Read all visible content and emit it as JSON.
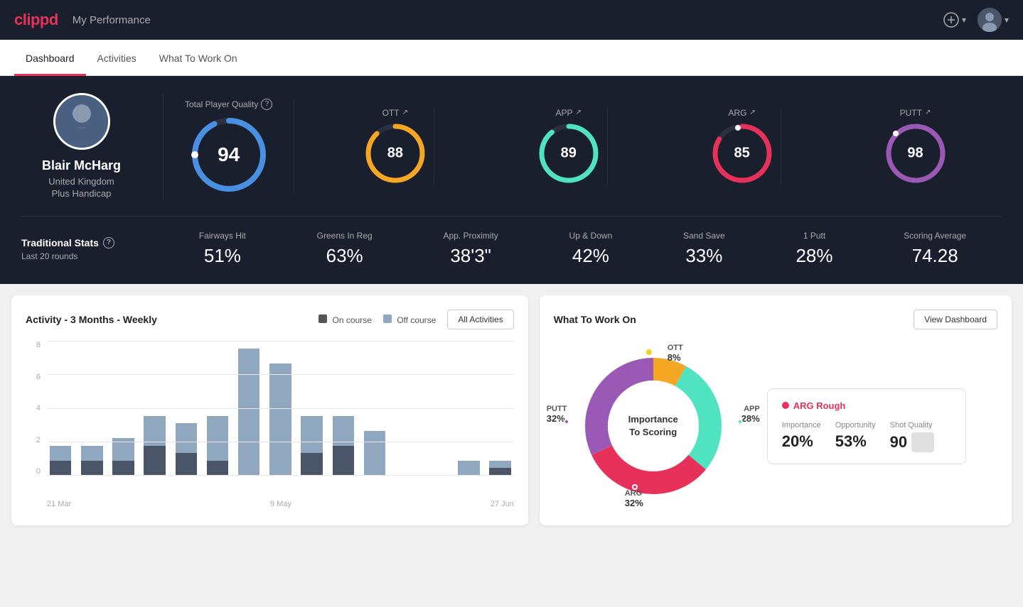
{
  "app": {
    "logo": "clippd",
    "header_title": "My Performance"
  },
  "nav": {
    "tabs": [
      {
        "id": "dashboard",
        "label": "Dashboard",
        "active": true
      },
      {
        "id": "activities",
        "label": "Activities",
        "active": false
      },
      {
        "id": "what-to-work-on",
        "label": "What To Work On",
        "active": false
      }
    ]
  },
  "player": {
    "name": "Blair McHarg",
    "country": "United Kingdom",
    "handicap": "Plus Handicap",
    "avatar_text": "👤"
  },
  "scores": {
    "total_quality_label": "Total Player Quality",
    "total_value": "94",
    "total_color": "#4a90e2",
    "categories": [
      {
        "label": "OTT",
        "value": "88",
        "color": "#f5a623"
      },
      {
        "label": "APP",
        "value": "89",
        "color": "#50e3c2"
      },
      {
        "label": "ARG",
        "value": "85",
        "color": "#e8315a"
      },
      {
        "label": "PUTT",
        "value": "98",
        "color": "#9b59b6"
      }
    ]
  },
  "trad_stats": {
    "title": "Traditional Stats",
    "subtitle": "Last 20 rounds",
    "items": [
      {
        "label": "Fairways Hit",
        "value": "51%"
      },
      {
        "label": "Greens In Reg",
        "value": "63%"
      },
      {
        "label": "App. Proximity",
        "value": "38'3\""
      },
      {
        "label": "Up & Down",
        "value": "42%"
      },
      {
        "label": "Sand Save",
        "value": "33%"
      },
      {
        "label": "1 Putt",
        "value": "28%"
      },
      {
        "label": "Scoring Average",
        "value": "74.28"
      }
    ]
  },
  "activity_chart": {
    "title": "Activity - 3 Months - Weekly",
    "legend": {
      "on_course": "On course",
      "off_course": "Off course"
    },
    "button_label": "All Activities",
    "y_labels": [
      "0",
      "2",
      "4",
      "6",
      "8"
    ],
    "x_labels": [
      "21 Mar",
      "9 May",
      "27 Jun"
    ],
    "bars": [
      {
        "on": 1,
        "off": 1
      },
      {
        "on": 1,
        "off": 1
      },
      {
        "on": 1,
        "off": 1.5
      },
      {
        "on": 2,
        "off": 2
      },
      {
        "on": 1.5,
        "off": 2
      },
      {
        "on": 1,
        "off": 3
      },
      {
        "on": 0,
        "off": 8.5
      },
      {
        "on": 0,
        "off": 7.5
      },
      {
        "on": 1.5,
        "off": 2.5
      },
      {
        "on": 2,
        "off": 2
      },
      {
        "on": 0,
        "off": 3
      },
      {
        "on": 0,
        "off": 0
      },
      {
        "on": 0,
        "off": 0
      },
      {
        "on": 0,
        "off": 1
      },
      {
        "on": 0.5,
        "off": 0.5
      }
    ]
  },
  "what_to_work_on": {
    "title": "What To Work On",
    "button_label": "View Dashboard",
    "donut_label": "Importance\nTo Scoring",
    "segments": [
      {
        "label": "OTT",
        "pct": 8,
        "color": "#f5a623",
        "pos": "top"
      },
      {
        "label": "APP",
        "pct": 28,
        "color": "#50e3c2",
        "pos": "right"
      },
      {
        "label": "ARG",
        "pct": 32,
        "color": "#e8315a",
        "pos": "bottom"
      },
      {
        "label": "PUTT",
        "pct": 32,
        "color": "#9b59b6",
        "pos": "left"
      }
    ],
    "info_card": {
      "title": "ARG Rough",
      "metrics": [
        {
          "label": "Importance",
          "value": "20%"
        },
        {
          "label": "Opportunity",
          "value": "53%"
        },
        {
          "label": "Shot Quality",
          "value": "90",
          "badge": true,
          "badge_color": "#e0e0e0"
        }
      ]
    }
  }
}
